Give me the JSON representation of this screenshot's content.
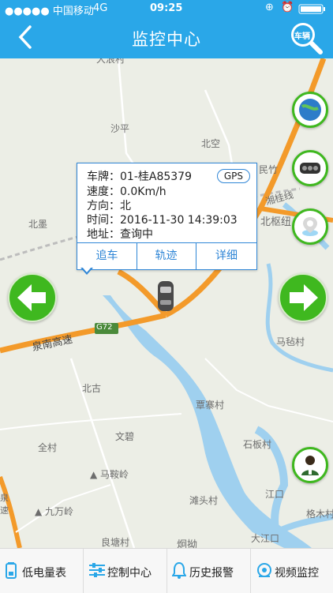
{
  "status_bar": {
    "carrier": "●●●●● 中国移动",
    "network": "4G",
    "time": "09:25"
  },
  "header": {
    "title": "监控中心",
    "search_icon_text": "车辆"
  },
  "map": {
    "labels": [
      "大浪村",
      "沙平",
      "北空",
      "北墨",
      "G72",
      "泉南高速",
      "北古",
      "马毡村",
      "覃寨村",
      "文碧",
      "全村",
      "马鞍岭",
      "石板村",
      "九万岭",
      "滩头村",
      "江口",
      "格木村",
      "良塘村",
      "炯拗",
      "大江口",
      "民竹",
      "湘桂线",
      "北枢纽"
    ],
    "left_edge_text": "泉\n速"
  },
  "vehicle_popup": {
    "plate_label": "车牌：",
    "plate": "01-桂A85379",
    "speed_label": "速度：",
    "speed": "0.0Km/h",
    "direction_label": "方向：",
    "direction": "北",
    "time_label": "时间：",
    "time": "2016-11-30 14:39:03",
    "address_label": "地址：",
    "address": "查询中",
    "gps_badge": "GPS",
    "buttons": {
      "track": "追车",
      "trace": "轨迹",
      "detail": "详细"
    }
  },
  "tabs": [
    {
      "label": "低电量表",
      "icon": "battery-icon"
    },
    {
      "label": "控制中心",
      "icon": "sliders-icon"
    },
    {
      "label": "历史报警",
      "icon": "history-alarm-icon"
    },
    {
      "label": "视频监控",
      "icon": "video-camera-icon"
    }
  ],
  "colors": {
    "header": "#2aa7e8",
    "accent_green": "#3fb81f",
    "popup_blue": "#2f86d6",
    "road_orange": "#f39a2a"
  }
}
